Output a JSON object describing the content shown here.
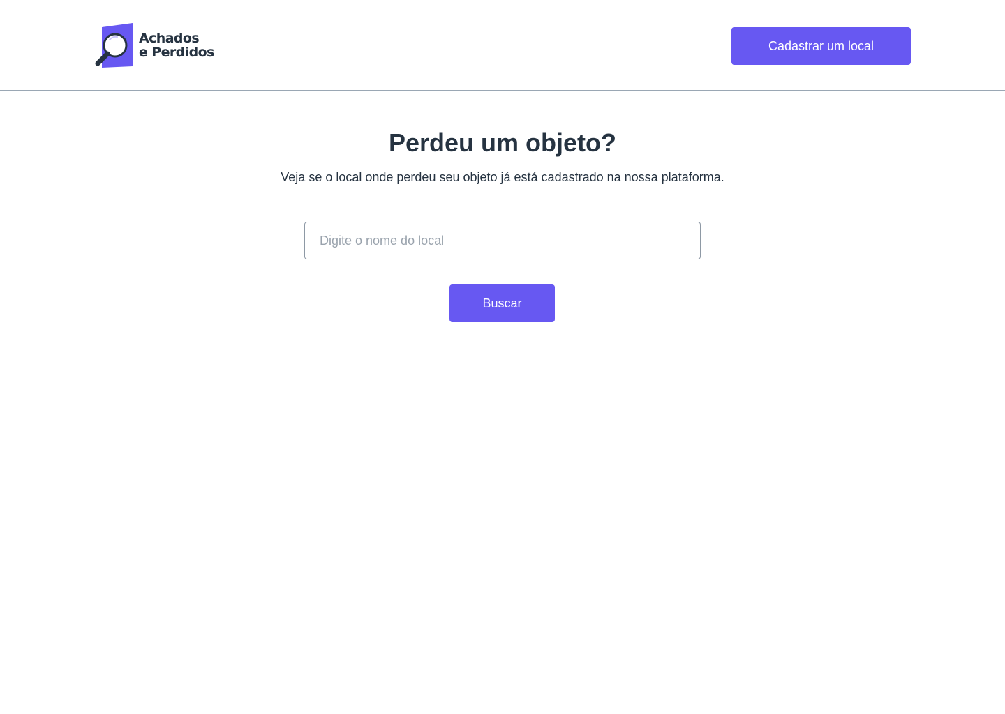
{
  "header": {
    "logo": {
      "line1": "Achados",
      "line2": "e Perdidos",
      "icon": "magnifying-glass-icon",
      "brand_color": "#6758f2"
    },
    "register_button_label": "Cadastrar um local"
  },
  "main": {
    "title": "Perdeu um objeto?",
    "subtitle": "Veja se o local onde perdeu seu objeto já está cadastrado na nossa plataforma.",
    "search": {
      "placeholder": "Digite o nome do local",
      "value": ""
    },
    "search_button_label": "Buscar"
  },
  "colors": {
    "accent": "#6758f2",
    "text": "#263341",
    "divider": "#9aa7b4"
  }
}
